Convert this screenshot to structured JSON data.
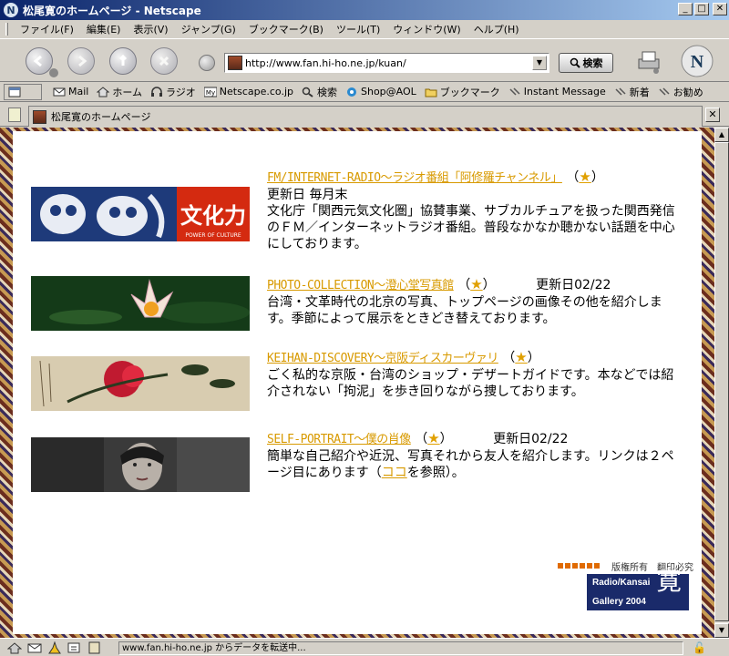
{
  "window": {
    "title": "松尾寛のホームページ - Netscape"
  },
  "menu": [
    "ファイル(F)",
    "編集(E)",
    "表示(V)",
    "ジャンプ(G)",
    "ブックマーク(B)",
    "ツール(T)",
    "ウィンドウ(W)",
    "ヘルプ(H)"
  ],
  "nav": {
    "url": "http://www.fan.hi-ho.ne.jp/kuan/",
    "search_label": "検索"
  },
  "personal_toolbar": [
    "Mail",
    "ホーム",
    "ラジオ",
    "Netscape.co.jp",
    "検索",
    "Shop@AOL",
    "ブックマーク",
    "Instant Message",
    "新着",
    "お勧め"
  ],
  "tab": {
    "label": "松尾寛のホームページ"
  },
  "entries": [
    {
      "link": "FM/INTERNET-RADIO～ラジオ番組「阿修羅チャンネル」",
      "star": "★",
      "updated": "更新日 毎月末",
      "desc": "文化庁「関西元気文化圏」協賛事業、サブカルチュアを扱った関西発信のＦＭ／インターネットラジオ番組。普段なかなか聴かない話題を中心にしております。"
    },
    {
      "link": "PHOTO-COLLECTION～澄心堂写真館",
      "star": "★",
      "updated": "更新日02/22",
      "desc": "台湾・文革時代の北京の写真、トップページの画像その他を紹介します。季節によって展示をときどき替えております。"
    },
    {
      "link": "KEIHAN-DISCOVERY～京阪ディスカーヴァリ",
      "star": "★",
      "updated": "",
      "desc": "ごく私的な京阪・台湾のショップ・デザートガイドです。本などでは紹介されない「拘泥」を歩き回りながら捜しております。"
    },
    {
      "link": "SELF-PORTRAIT～僕の肖像",
      "star": "★",
      "updated": "更新日02/22",
      "desc_pre": "簡単な自己紹介や近況、写真それから友人を紹介します。リンクは２ページ目にあります（",
      "desc_link": "ココ",
      "desc_post": "を参照）。"
    }
  ],
  "banner": {
    "bunka_text": "文化力",
    "bunka_sub": "POWER OF CULTURE"
  },
  "footer": {
    "copyright": "版権所有　翻印必究",
    "badge_line1": "Radio/Kansai",
    "badge_line2": "Gallery 2004",
    "badge_kanji": "寛"
  },
  "status": {
    "text": "www.fan.hi-ho.ne.jp からデータを転送中..."
  }
}
